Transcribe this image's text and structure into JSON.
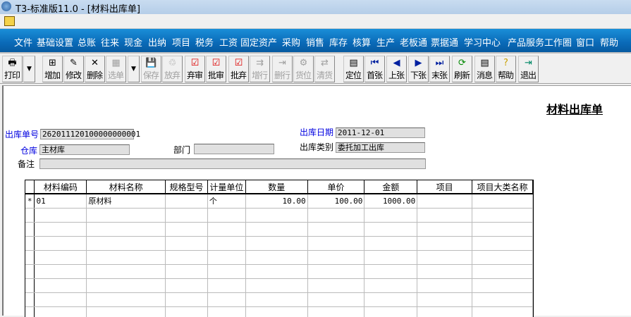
{
  "window": {
    "title": "T3-标准版11.0 - [材料出库单]"
  },
  "menu": [
    "文件",
    "基础设置",
    "总账",
    "往来",
    "现金",
    "出纳",
    "项目",
    "税务",
    "工资",
    "固定资产",
    "采购",
    "销售",
    "库存",
    "核算",
    "生产",
    "老板通",
    "票据通",
    "学习中心",
    "产品服务",
    "工作圈",
    "窗口",
    "帮助"
  ],
  "toolbar": [
    {
      "label": "打印",
      "icon": "printer-icon",
      "enabled": true
    },
    {
      "label": "增加",
      "icon": "add-icon",
      "enabled": true
    },
    {
      "label": "修改",
      "icon": "edit-icon",
      "enabled": true
    },
    {
      "label": "删除",
      "icon": "delete-icon",
      "enabled": true
    },
    {
      "label": "选单",
      "icon": "select-icon",
      "enabled": false
    },
    {
      "label": "保存",
      "icon": "save-icon",
      "enabled": false
    },
    {
      "label": "放弃",
      "icon": "discard-icon",
      "enabled": false
    },
    {
      "label": "弃审",
      "icon": "unaudit-icon",
      "enabled": true
    },
    {
      "label": "批审",
      "icon": "batch-audit-icon",
      "enabled": true
    },
    {
      "label": "批弃",
      "icon": "batch-unaudit-icon",
      "enabled": true
    },
    {
      "label": "增行",
      "icon": "add-row-icon",
      "enabled": false
    },
    {
      "label": "删行",
      "icon": "delete-row-icon",
      "enabled": false
    },
    {
      "label": "货位",
      "icon": "location-icon",
      "enabled": false
    },
    {
      "label": "清货",
      "icon": "clear-icon",
      "enabled": false
    },
    {
      "label": "定位",
      "icon": "locate-icon",
      "enabled": true
    },
    {
      "label": "首张",
      "icon": "first-icon",
      "enabled": true
    },
    {
      "label": "上张",
      "icon": "prev-icon",
      "enabled": true
    },
    {
      "label": "下张",
      "icon": "next-icon",
      "enabled": true
    },
    {
      "label": "末张",
      "icon": "last-icon",
      "enabled": true
    },
    {
      "label": "刷新",
      "icon": "refresh-icon",
      "enabled": true
    },
    {
      "label": "消息",
      "icon": "message-icon",
      "enabled": true
    },
    {
      "label": "帮助",
      "icon": "help-icon",
      "enabled": true
    },
    {
      "label": "退出",
      "icon": "exit-icon",
      "enabled": true
    }
  ],
  "form": {
    "title": "材料出库单",
    "doc_no_label": "出库单号",
    "doc_no": "262011120100000000001",
    "date_label": "出库日期",
    "date": "2011-12-01",
    "warehouse_label": "仓库",
    "warehouse": "主材库",
    "dept_label": "部门",
    "dept": "",
    "type_label": "出库类别",
    "type": "委托加工出库",
    "remark_label": "备注",
    "remark": ""
  },
  "grid": {
    "columns": [
      "材料编码",
      "材料名称",
      "规格型号",
      "计量单位",
      "数量",
      "单价",
      "金额",
      "项目",
      "项目大类名称"
    ],
    "rows": [
      [
        "01",
        "原材料",
        "",
        "个",
        "10.00",
        "100.00",
        "1000.00",
        "",
        ""
      ]
    ],
    "current_marker": "*"
  }
}
